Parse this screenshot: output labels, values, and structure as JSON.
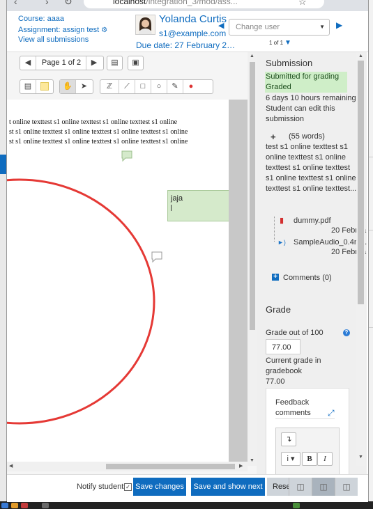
{
  "browser": {
    "url_host": "localhost",
    "url_path": "/integration_3/mod/ass..."
  },
  "header": {
    "course": "Course: aaaa",
    "assignment": "Assignment: assign test",
    "view_all": "View all submissions",
    "user_name": "Yolanda Curtis",
    "user_email": "s1@example.com",
    "due_date": "Due date: 27 February 2…",
    "change_user_placeholder": "Change user",
    "page_count": "1 of 1"
  },
  "toolbar": {
    "page_label": "Page 1 of 2"
  },
  "document": {
    "lines": [
      "t online texttest s1 online texttest s1 online texttest s1 online",
      "st s1 online texttest s1 online texttest s1 online texttest s1 online",
      "st s1 online texttest s1 online texttest s1 online texttest s1 online"
    ],
    "comment_text": "jaja"
  },
  "submission": {
    "heading": "Submission",
    "status_1": "Submitted for grading",
    "status_2": "Graded",
    "time_remaining": "6 days 10 hours remaining",
    "edit_note_1": "Student can edit this",
    "edit_note_2": "submission",
    "word_count": "(55 words)",
    "text_lines": [
      "test s1 online texttest s1",
      "online texttest s1 online",
      "texttest s1 online texttest",
      "s1 online texttest s1 online",
      "texttest s1 online texttest..."
    ],
    "files": [
      {
        "name": "dummy.pdf",
        "date": "20 Februa"
      },
      {
        "name": "SampleAudio_0.4mb.r",
        "date": "20 Februa"
      }
    ],
    "comments_link": "Comments (0)"
  },
  "grade": {
    "heading": "Grade",
    "grade_out_of": "Grade out of 100",
    "grade_value": "77.00",
    "current_grade_label_1": "Current grade in",
    "current_grade_label_2": "gradebook",
    "current_grade_value": "77.00",
    "feedback_label_1": "Feedback",
    "feedback_label_2": "comments"
  },
  "footer": {
    "notify_label": "Notify students",
    "save_changes": "Save changes",
    "save_show_next": "Save and show next",
    "reset": "Rese"
  },
  "colors": {
    "link": "#0f6cbf",
    "status_bg": "#cfeec8",
    "annotation_red": "#e53935",
    "comment_bg": "#d5eacb"
  }
}
